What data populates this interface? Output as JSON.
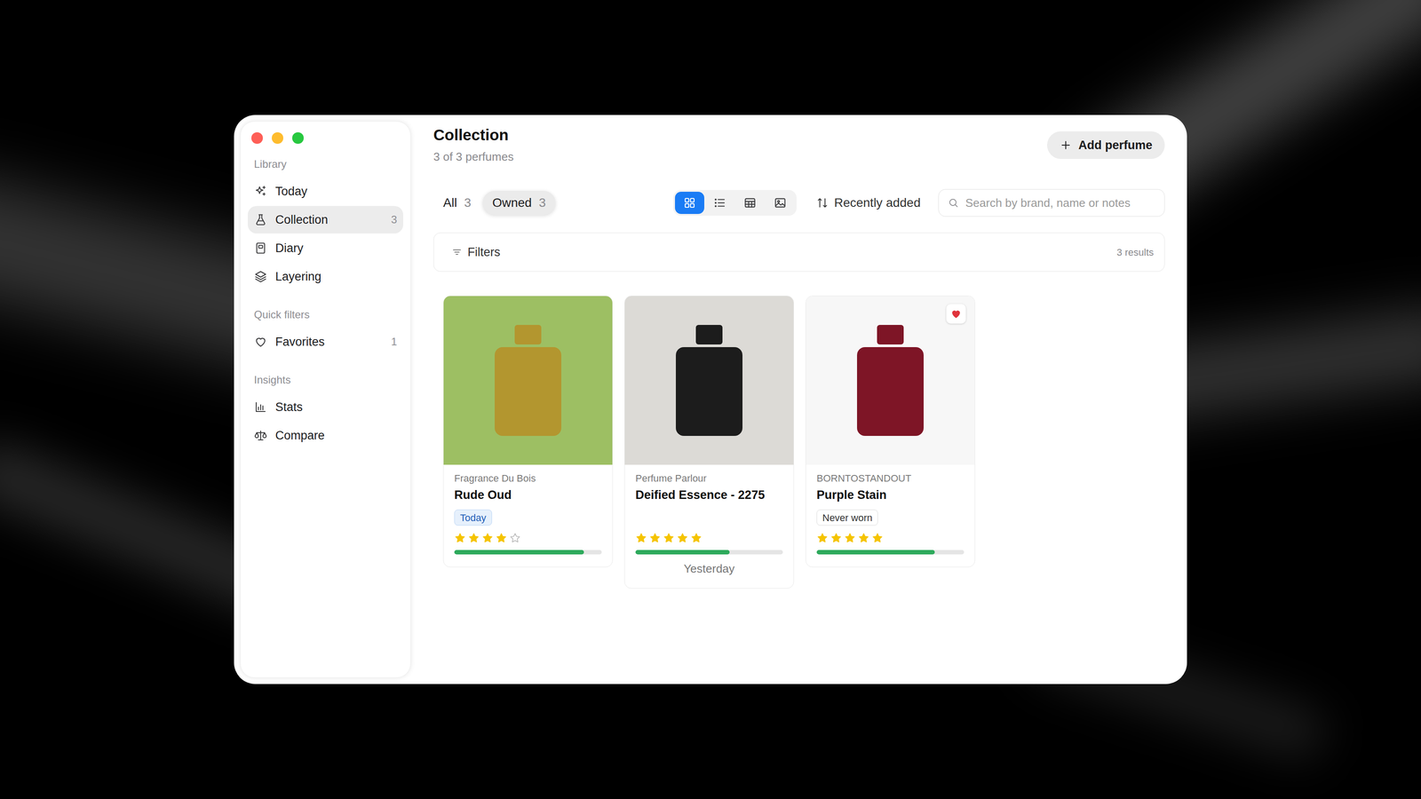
{
  "window": {
    "title": "Collection",
    "subtitle": "3 of 3 perfumes"
  },
  "sidebar": {
    "sections": [
      {
        "heading": "Library",
        "items": [
          {
            "label": "Today",
            "selected": false
          },
          {
            "label": "Collection",
            "count": "3",
            "selected": true
          },
          {
            "label": "Diary",
            "selected": false
          },
          {
            "label": "Layering",
            "selected": false
          }
        ]
      },
      {
        "heading": "Quick filters",
        "items": [
          {
            "label": "Favorites",
            "count": "1",
            "selected": false
          }
        ]
      },
      {
        "heading": "Insights",
        "items": [
          {
            "label": "Stats",
            "selected": false
          },
          {
            "label": "Compare",
            "selected": false
          }
        ]
      }
    ]
  },
  "add_button": {
    "label": "Add perfume"
  },
  "segments": [
    {
      "label": "All",
      "count": "3",
      "selected": false
    },
    {
      "label": "Owned",
      "count": "3",
      "selected": true
    }
  ],
  "view_modes": [
    {
      "kind": "grid",
      "selected": true
    },
    {
      "kind": "list",
      "selected": false
    },
    {
      "kind": "table",
      "selected": false
    },
    {
      "kind": "gallery",
      "selected": false
    }
  ],
  "sort": {
    "label": "Recently added"
  },
  "search": {
    "placeholder": "Search by brand, name or notes"
  },
  "filters": {
    "label": "Filters",
    "results": "3 results"
  },
  "cards": [
    {
      "brand": "Fragrance Du Bois",
      "name": "Rude Oud",
      "badge": {
        "label": "Today",
        "kind": "today"
      },
      "stars": 4,
      "level": 0.88,
      "favorite": false,
      "worn": null,
      "photo": {
        "ground": "#9dbf63",
        "bottle": "#b3962f"
      }
    },
    {
      "brand": "Perfume Parlour",
      "name": "Deified Essence - 2275",
      "badge": null,
      "stars": 5,
      "level": 0.64,
      "favorite": false,
      "worn": "Yesterday",
      "photo": {
        "ground": "#dcdad6",
        "bottle": "#1c1c1c"
      }
    },
    {
      "brand": "BORNTOSTANDOUT",
      "name": "Purple Stain",
      "badge": {
        "label": "Never worn",
        "kind": "never"
      },
      "stars": 5,
      "level": 0.8,
      "favorite": true,
      "worn": null,
      "photo": {
        "ground": "#f7f7f7",
        "bottle": "#7e1526"
      }
    }
  ]
}
